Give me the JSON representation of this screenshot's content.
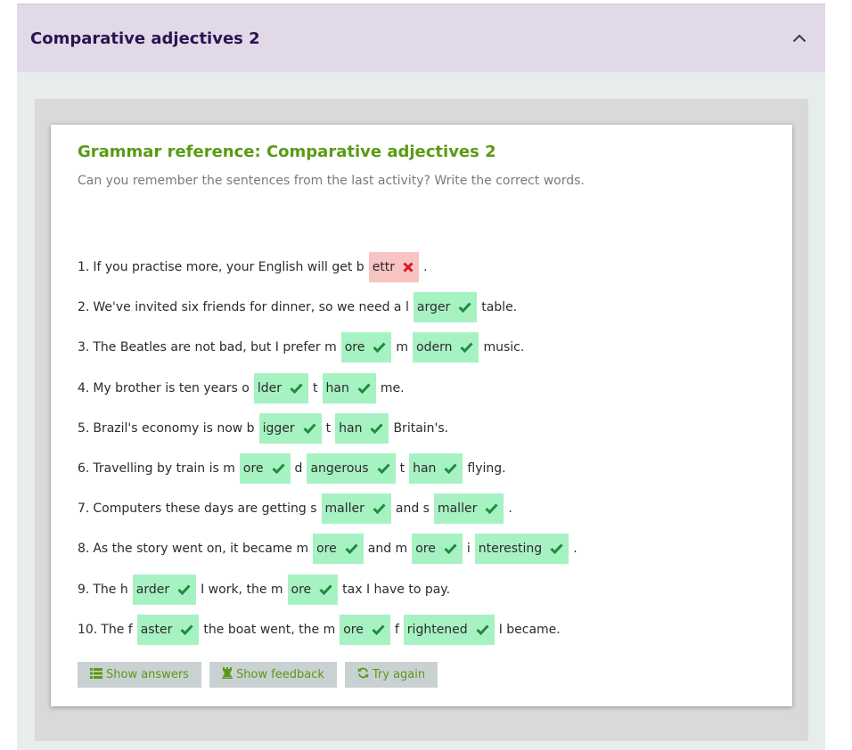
{
  "accordion": {
    "title": "Comparative adjectives 2"
  },
  "card": {
    "title": "Grammar reference: Comparative adjectives 2",
    "instruction": "Can you remember the sentences from the last activity? Write the correct words."
  },
  "questions": [
    {
      "num": "1.",
      "parts": [
        {
          "t": "text",
          "v": "If you practise more, your English will get b"
        },
        {
          "t": "gap",
          "v": "ettr",
          "ok": false
        },
        {
          "t": "text",
          "v": "."
        }
      ]
    },
    {
      "num": "2.",
      "parts": [
        {
          "t": "text",
          "v": "We've invited six friends for dinner, so we need a l"
        },
        {
          "t": "gap",
          "v": "arger",
          "ok": true
        },
        {
          "t": "text",
          "v": "table."
        }
      ]
    },
    {
      "num": "3.",
      "parts": [
        {
          "t": "text",
          "v": "The Beatles are not bad, but I prefer m"
        },
        {
          "t": "gap",
          "v": "ore",
          "ok": true
        },
        {
          "t": "text",
          "v": "m"
        },
        {
          "t": "gap",
          "v": "odern",
          "ok": true
        },
        {
          "t": "text",
          "v": "music."
        }
      ]
    },
    {
      "num": "4.",
      "parts": [
        {
          "t": "text",
          "v": "My brother is ten years o"
        },
        {
          "t": "gap",
          "v": "lder",
          "ok": true
        },
        {
          "t": "text",
          "v": "t"
        },
        {
          "t": "gap",
          "v": "han",
          "ok": true
        },
        {
          "t": "text",
          "v": "me."
        }
      ]
    },
    {
      "num": "5.",
      "parts": [
        {
          "t": "text",
          "v": "Brazil's economy is now b"
        },
        {
          "t": "gap",
          "v": "igger",
          "ok": true
        },
        {
          "t": "text",
          "v": "t"
        },
        {
          "t": "gap",
          "v": "han",
          "ok": true
        },
        {
          "t": "text",
          "v": "Britain's."
        }
      ]
    },
    {
      "num": "6.",
      "parts": [
        {
          "t": "text",
          "v": "Travelling by train is m"
        },
        {
          "t": "gap",
          "v": "ore",
          "ok": true
        },
        {
          "t": "text",
          "v": "d"
        },
        {
          "t": "gap",
          "v": "angerous",
          "ok": true
        },
        {
          "t": "text",
          "v": "t"
        },
        {
          "t": "gap",
          "v": "han",
          "ok": true
        },
        {
          "t": "text",
          "v": "flying."
        }
      ]
    },
    {
      "num": "7.",
      "parts": [
        {
          "t": "text",
          "v": "Computers these days are getting s"
        },
        {
          "t": "gap",
          "v": "maller",
          "ok": true
        },
        {
          "t": "text",
          "v": "and s"
        },
        {
          "t": "gap",
          "v": "maller",
          "ok": true
        },
        {
          "t": "text",
          "v": "."
        }
      ]
    },
    {
      "num": "8.",
      "parts": [
        {
          "t": "text",
          "v": "As the story went on, it became m"
        },
        {
          "t": "gap",
          "v": "ore",
          "ok": true
        },
        {
          "t": "text",
          "v": "and m"
        },
        {
          "t": "gap",
          "v": "ore",
          "ok": true
        },
        {
          "t": "text",
          "v": "i"
        },
        {
          "t": "gap",
          "v": "nteresting",
          "ok": true
        },
        {
          "t": "text",
          "v": "."
        }
      ]
    },
    {
      "num": "9.",
      "parts": [
        {
          "t": "text",
          "v": "The h"
        },
        {
          "t": "gap",
          "v": "arder",
          "ok": true
        },
        {
          "t": "text",
          "v": "I work, the m"
        },
        {
          "t": "gap",
          "v": "ore",
          "ok": true
        },
        {
          "t": "text",
          "v": "tax I have to pay."
        }
      ]
    },
    {
      "num": "10.",
      "parts": [
        {
          "t": "text",
          "v": "The f"
        },
        {
          "t": "gap",
          "v": "aster",
          "ok": true
        },
        {
          "t": "text",
          "v": "the boat went, the m"
        },
        {
          "t": "gap",
          "v": "ore",
          "ok": true
        },
        {
          "t": "text",
          "v": "f"
        },
        {
          "t": "gap",
          "v": "rightened",
          "ok": true
        },
        {
          "t": "text",
          "v": "I became."
        }
      ]
    }
  ],
  "buttons": {
    "show_answers": "Show answers",
    "show_feedback": "Show feedback",
    "try_again": "Try again"
  },
  "icons": {
    "correct": "check-icon",
    "wrong": "cross-icon",
    "show_answers": "list-icon",
    "show_feedback": "chess-rook-icon",
    "try_again": "refresh-icon",
    "accordion_toggle": "chevron-up-icon"
  },
  "colors": {
    "correct_bg": "#a7f2c3",
    "correct_mark": "#1e8c3a",
    "wrong_bg": "#f8c3c3",
    "wrong_mark": "#e0141e",
    "heading": "#5a9a15",
    "accordion_title": "#2c1250"
  }
}
